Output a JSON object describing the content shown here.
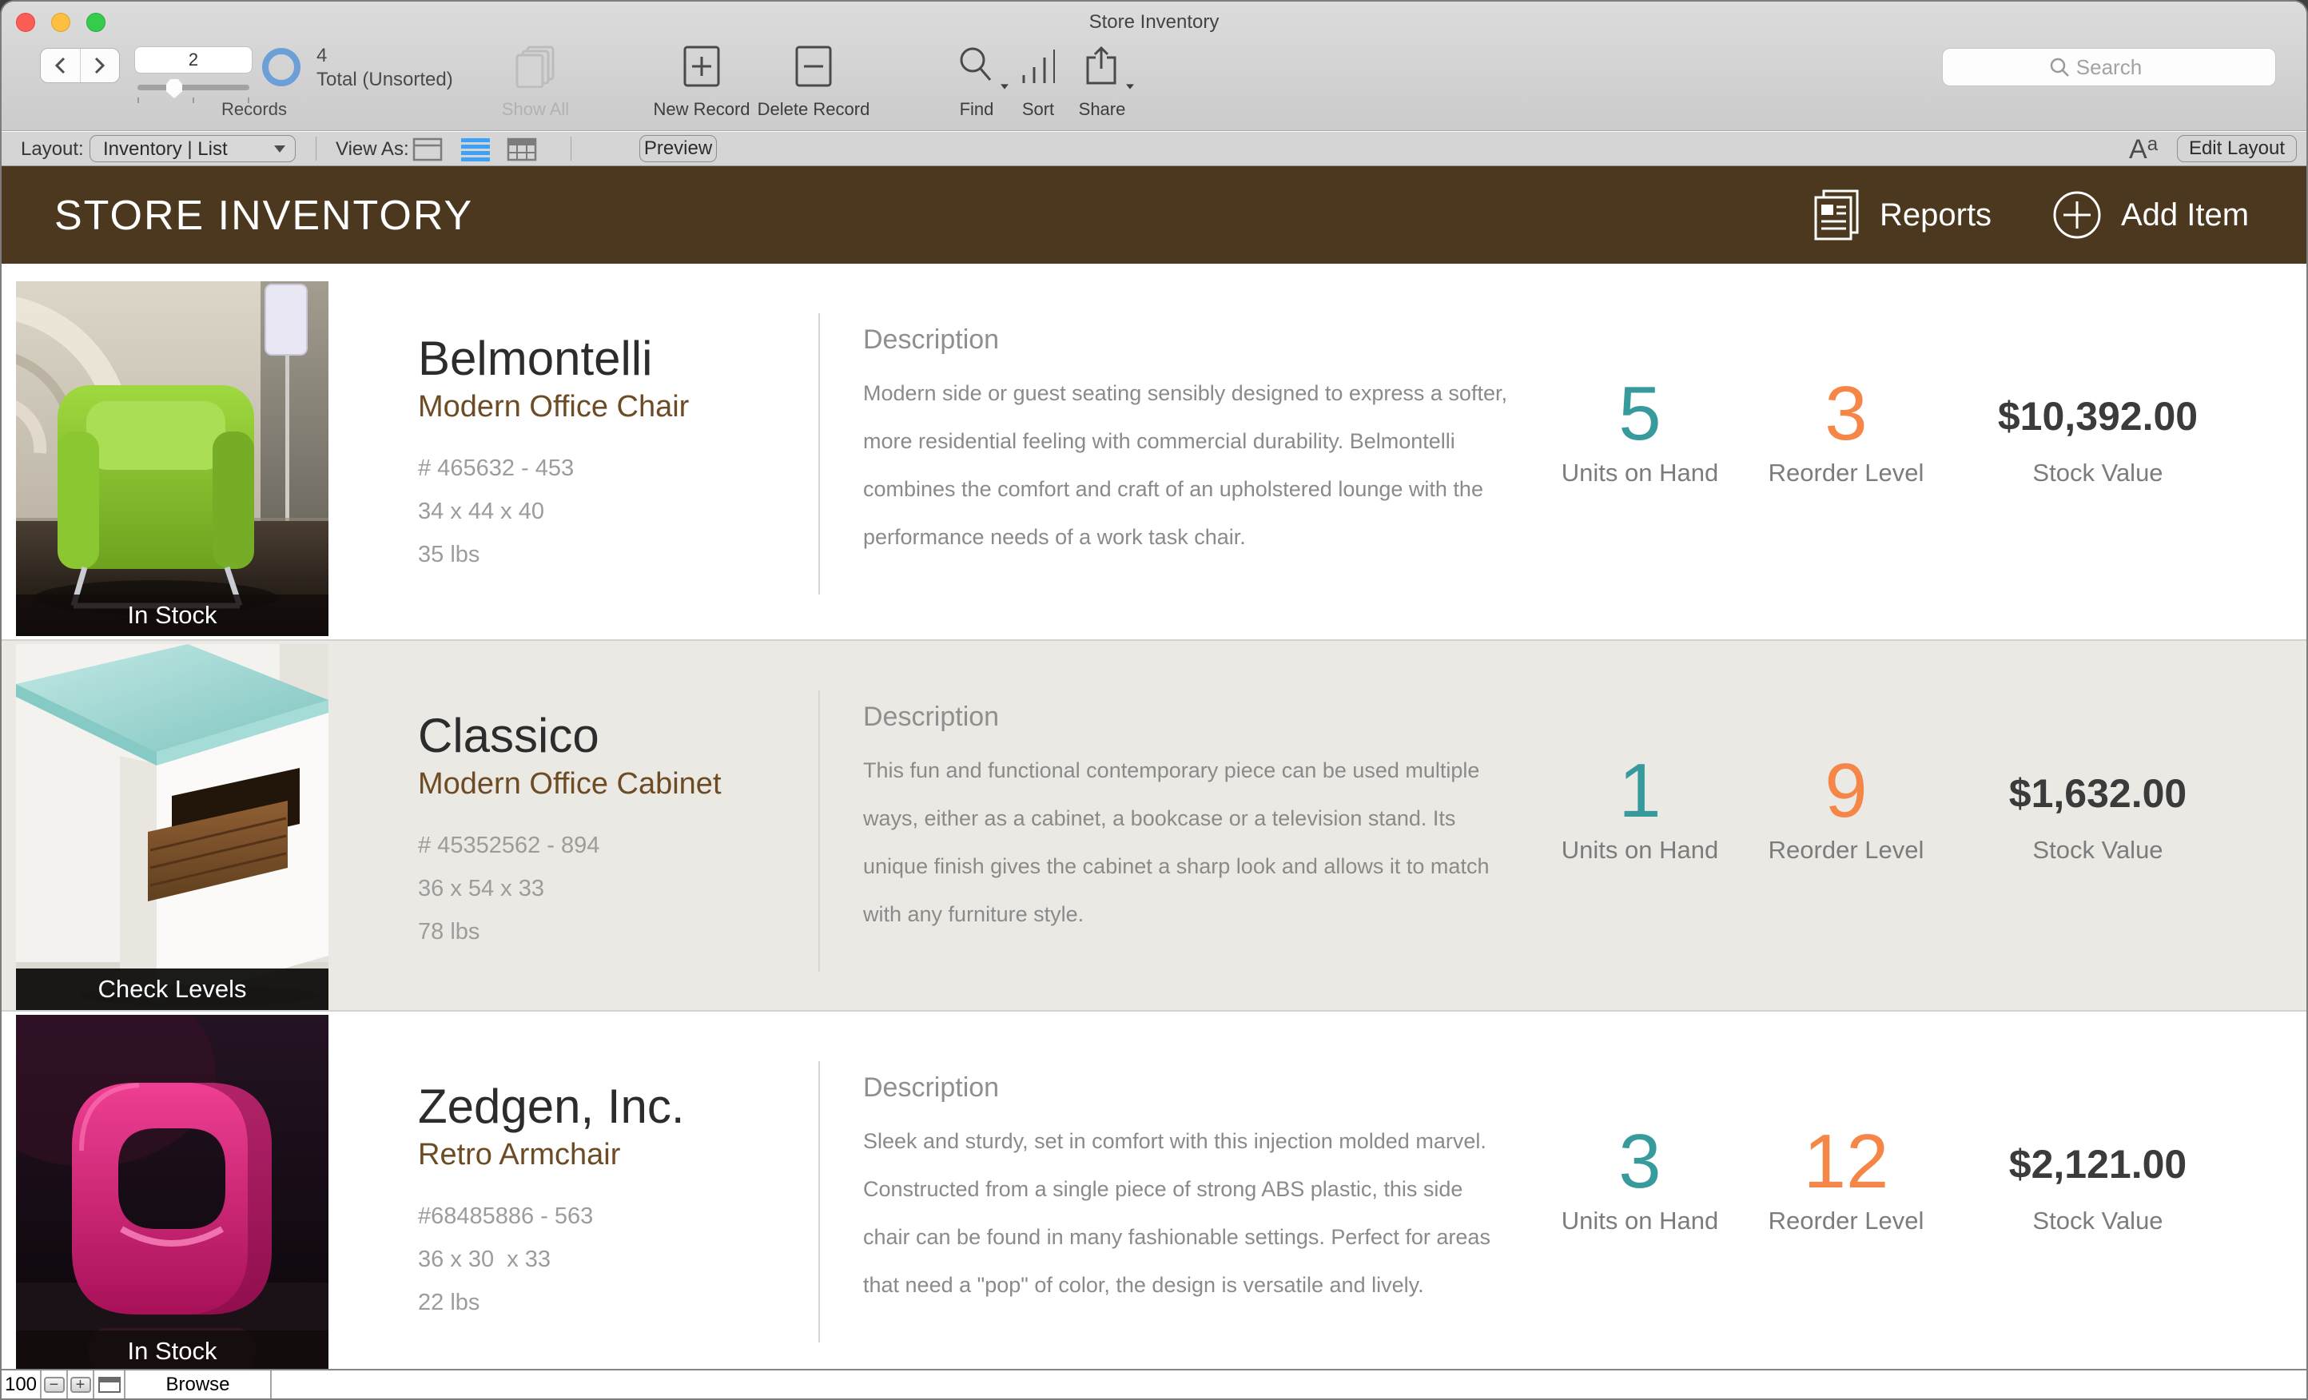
{
  "window": {
    "title": "Store Inventory"
  },
  "toolbar": {
    "record_number": "2",
    "records_label": "Records",
    "found_count": "4",
    "found_label": "Total (Unsorted)",
    "show_all_label": "Show All",
    "new_record_label": "New Record",
    "delete_record_label": "Delete Record",
    "find_label": "Find",
    "sort_label": "Sort",
    "share_label": "Share",
    "search_placeholder": "Search"
  },
  "layout_bar": {
    "layout_label": "Layout:",
    "layout_value": "Inventory | List",
    "view_as_label": "View As:",
    "preview_label": "Preview",
    "format_A": "A",
    "format_a": "a",
    "edit_layout_label": "Edit Layout"
  },
  "header": {
    "title": "STORE INVENTORY",
    "reports_label": "Reports",
    "add_item_label": "Add Item"
  },
  "labels": {
    "description": "Description",
    "units": "Units on Hand",
    "reorder": "Reorder Level",
    "stock": "Stock Value"
  },
  "items": [
    {
      "name": "Belmontelli",
      "subtitle": "Modern Office Chair",
      "item_no": "# 465632 - 453",
      "dimensions": "34 x 44 x 40",
      "weight": "35 lbs",
      "badge": "In Stock",
      "description": "Modern side or guest seating sensibly designed to express a softer,\nmore residential feeling with commercial durability. Belmontelli\ncombines the comfort and craft of an upholstered lounge with the\nperformance needs of a work task chair.",
      "units_on_hand": "5",
      "reorder_level": "3",
      "stock_value": "$10,392.00"
    },
    {
      "name": "Classico",
      "subtitle": "Modern Office Cabinet",
      "item_no": "# 45352562 - 894",
      "dimensions": "36 x 54 x 33",
      "weight": "78 lbs",
      "badge": "Check Levels",
      "description": "This fun and functional contemporary piece can be used multiple\nways, either as a cabinet, a bookcase or a television stand. Its\nunique finish gives the cabinet a sharp look and allows it to match\nwith any furniture style.",
      "units_on_hand": "1",
      "reorder_level": "9",
      "stock_value": "$1,632.00"
    },
    {
      "name": "Zedgen, Inc.",
      "subtitle": "Retro Armchair",
      "item_no": "#68485886 - 563",
      "dimensions": "36 x 30  x 33",
      "weight": "22 lbs",
      "badge": "In Stock",
      "description": "Sleek and sturdy, set in comfort with this injection molded marvel.\nConstructed from a single piece of strong ABS plastic, this side\nchair can be found in many fashionable settings. Perfect for areas\nthat need a \"pop\" of color, the design is versatile and lively.",
      "units_on_hand": "3",
      "reorder_level": "12",
      "stock_value": "$2,121.00"
    }
  ],
  "status_bar": {
    "zoom_level": "100",
    "mode_label": "Browse"
  },
  "colors": {
    "header_brown": "#4c381e",
    "accent_teal": "#379a9d",
    "accent_orange": "#f58647"
  }
}
